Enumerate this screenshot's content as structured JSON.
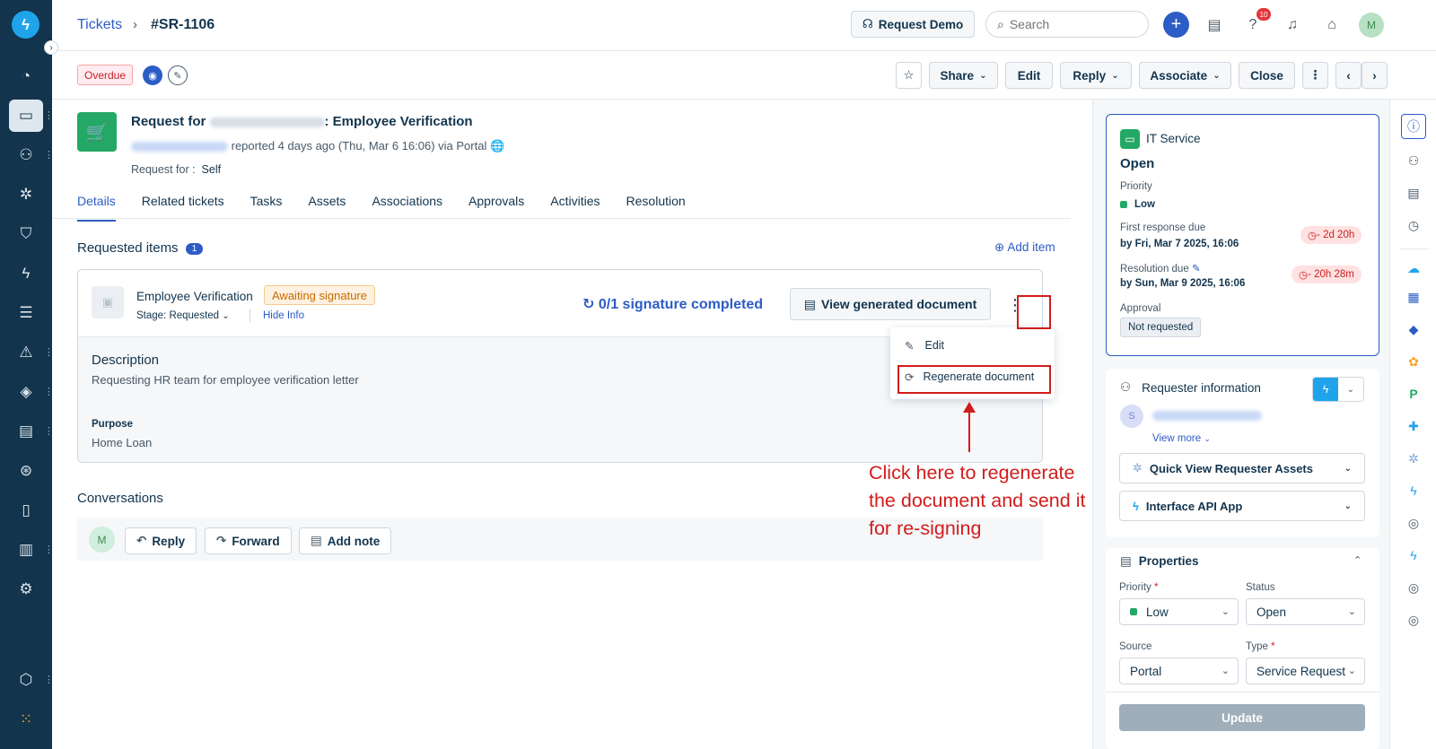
{
  "header": {
    "breadcrumb_root": "Tickets",
    "breadcrumb_sep": "›",
    "ticket_id": "#SR-1106",
    "request_demo": "Request Demo",
    "search_placeholder": "Search",
    "help_badge": "10",
    "user_initial": "M"
  },
  "toolbar": {
    "status_tag": "Overdue",
    "share": "Share",
    "edit": "Edit",
    "reply": "Reply",
    "associate": "Associate",
    "close": "Close"
  },
  "ticket": {
    "title_prefix": "Request for",
    "title_suffix": ": Employee Verification",
    "reported": "reported 4 days ago (Thu, Mar 6 16:06) via Portal",
    "request_for_label": "Request for :",
    "request_for_value": "Self"
  },
  "tabs": [
    "Details",
    "Related tickets",
    "Tasks",
    "Assets",
    "Associations",
    "Approvals",
    "Activities",
    "Resolution"
  ],
  "requested_items": {
    "title": "Requested items",
    "count": "1",
    "add_item": "Add item",
    "item_name": "Employee Verification",
    "item_status": "Awaiting signature",
    "stage": "Stage: Requested",
    "hide_info": "Hide Info",
    "signature_progress": "0/1 signature completed",
    "view_document": "View generated document",
    "description_heading": "Description",
    "description_text": "Requesting HR team for employee verification letter",
    "purpose_label": "Purpose",
    "purpose_value": "Home Loan"
  },
  "menu": {
    "edit": "Edit",
    "regenerate": "Regenerate document"
  },
  "annotation": {
    "text": "Click here to regenerate the document and send it for re-signing"
  },
  "conversations": {
    "title": "Conversations",
    "avatar": "M",
    "reply": "Reply",
    "forward": "Forward",
    "add_note": "Add note"
  },
  "status_card": {
    "group": "IT Service",
    "status": "Open",
    "priority_label": "Priority",
    "priority_value": "Low",
    "first_response_label": "First response due",
    "first_response_value": "by Fri, Mar 7 2025, 16:06",
    "first_response_pill": "- 2d 20h",
    "resolution_label": "Resolution due",
    "resolution_value": "by Sun, Mar 9 2025, 16:06",
    "resolution_pill": "- 20h 28m",
    "approval_label": "Approval",
    "approval_value": "Not requested"
  },
  "requester": {
    "title": "Requester information",
    "avatar": "S",
    "view_more": "View more",
    "quick_view": "Quick View Requester Assets",
    "interface_app": "Interface API App"
  },
  "properties": {
    "title": "Properties",
    "priority_label": "Priority",
    "priority_value": "Low",
    "status_label": "Status",
    "status_value": "Open",
    "source_label": "Source",
    "source_value": "Portal",
    "type_label": "Type",
    "type_value": "Service Request",
    "required_mark": "*",
    "update": "Update"
  },
  "colors": {
    "brand_blue": "#2c5cc5",
    "sidebar": "#12344d",
    "annotation_red": "#d21c1c",
    "success_green": "#24a865"
  }
}
